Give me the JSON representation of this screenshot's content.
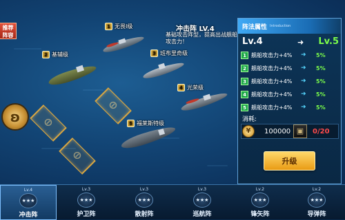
{
  "recommend_badge": "推荐\n阵容",
  "formation": {
    "title": "冲击阵 LV.4",
    "description": "基础攻击阵型，提高出战舰船攻击力！"
  },
  "ships": [
    {
      "rank": "1",
      "name": "无畏I级"
    },
    {
      "rank": "2",
      "name": "基辅级"
    },
    {
      "rank": "3",
      "name": "班布里奇级"
    },
    {
      "rank": "4",
      "name": "光荣级"
    },
    {
      "rank": "5",
      "name": "福莱斯特级"
    }
  ],
  "panel": {
    "title": "阵法属性",
    "title_sub": "Introduction",
    "level_current": "Lv.4",
    "level_next": "Lv.5",
    "attributes": [
      {
        "num": "1",
        "text": "舰船攻击力+4%",
        "next": "5%"
      },
      {
        "num": "2",
        "text": "舰船攻击力+4%",
        "next": "5%"
      },
      {
        "num": "3",
        "text": "舰船攻击力+4%",
        "next": "5%"
      },
      {
        "num": "4",
        "text": "舰船攻击力+4%",
        "next": "5%"
      },
      {
        "num": "5",
        "text": "舰船攻击力+4%",
        "next": "5%"
      }
    ],
    "cost_label": "消耗:",
    "coin_amount": "100000",
    "item_amount": "0/20",
    "upgrade_label": "升级"
  },
  "tabs": [
    {
      "level": "Lv.4",
      "label": "冲击阵",
      "active": true
    },
    {
      "level": "Lv.3",
      "label": "护卫阵",
      "active": false
    },
    {
      "level": "Lv.3",
      "label": "散射阵",
      "active": false
    },
    {
      "level": "Lv.3",
      "label": "巡航阵",
      "active": false
    },
    {
      "level": "Lv.2",
      "label": "锋矢阵",
      "active": false
    },
    {
      "level": "Lv.2",
      "label": "导弹阵",
      "active": false
    }
  ],
  "colors": {
    "accent_green": "#7dff4a",
    "cost_red": "#ff4a4a",
    "upgrade_gold": "#e99b14",
    "panel_blue": "#3fa9f5"
  },
  "icons": [
    "coin-icon",
    "blueprint-item-icon",
    "wing-emblem-icon",
    "formation-star-icon"
  ]
}
